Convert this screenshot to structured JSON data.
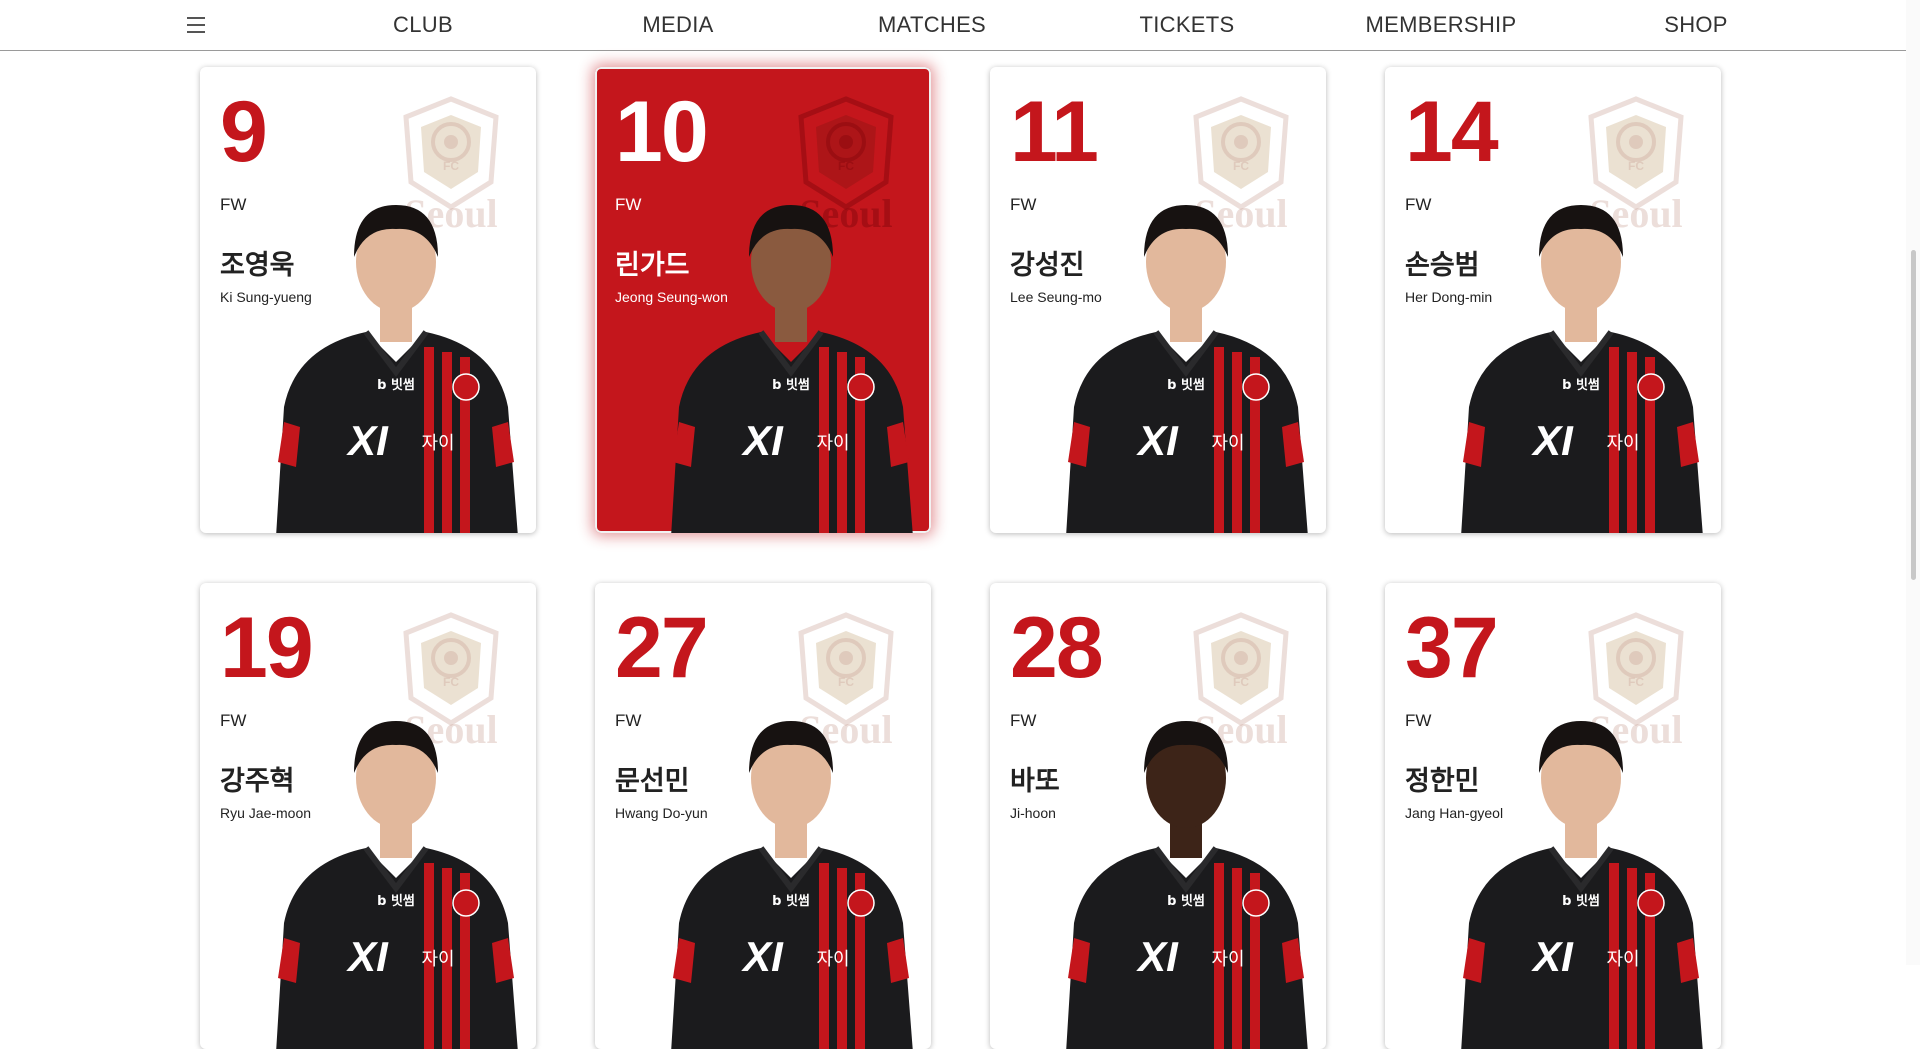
{
  "nav": {
    "items": [
      "CLUB",
      "MEDIA",
      "MATCHES",
      "TICKETS",
      "MEMBERSHIP",
      "SHOP"
    ]
  },
  "colors": {
    "brand_red": "#c4161c",
    "jersey_black": "#1b1b1d",
    "stripe_red": "#c4161c"
  },
  "players": [
    {
      "number": "9",
      "position": "FW",
      "name_kr": "조영욱",
      "name_en": "Ki Sung-yueng",
      "active": false
    },
    {
      "number": "10",
      "position": "FW",
      "name_kr": "린가드",
      "name_en": "Jeong Seung-won",
      "active": true
    },
    {
      "number": "11",
      "position": "FW",
      "name_kr": "강성진",
      "name_en": "Lee Seung-mo",
      "active": false
    },
    {
      "number": "14",
      "position": "FW",
      "name_kr": "손승범",
      "name_en": "Her Dong-min",
      "active": false
    },
    {
      "number": "19",
      "position": "FW",
      "name_kr": "강주혁",
      "name_en": "Ryu Jae-moon",
      "active": false
    },
    {
      "number": "27",
      "position": "FW",
      "name_kr": "문선민",
      "name_en": "Hwang Do-yun",
      "active": false
    },
    {
      "number": "28",
      "position": "FW",
      "name_kr": "바또",
      "name_en": "Ji-hoon",
      "active": false
    },
    {
      "number": "37",
      "position": "FW",
      "name_kr": "정한민",
      "name_en": "Jang Han-gyeol",
      "active": false
    }
  ],
  "crest": {
    "text": "Seoul",
    "sub": "FC"
  },
  "jersey": {
    "sponsor_main": "XI",
    "sponsor_sub": "자이",
    "chest_logo": "b 빗썸"
  }
}
